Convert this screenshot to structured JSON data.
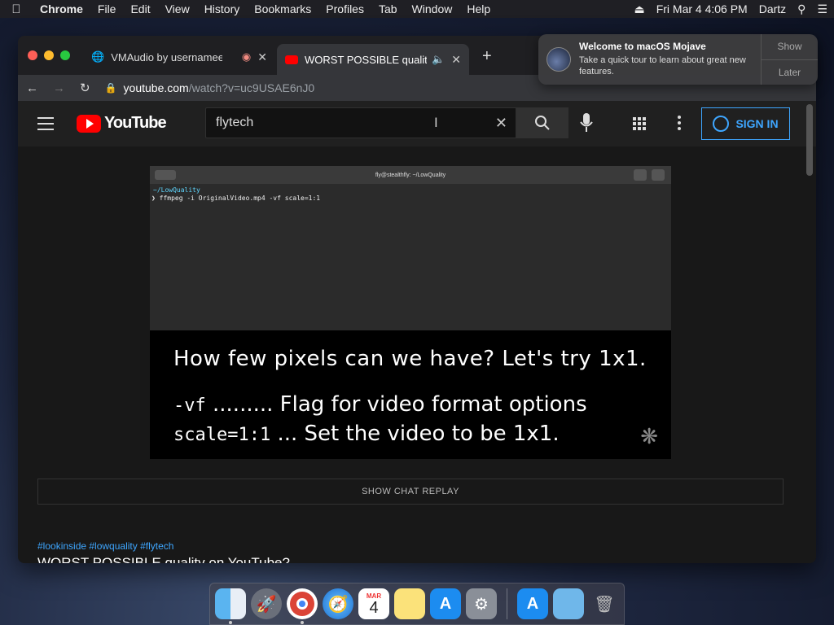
{
  "menubar": {
    "app": "Chrome",
    "items": [
      "File",
      "Edit",
      "View",
      "History",
      "Bookmarks",
      "Profiles",
      "Tab",
      "Window",
      "Help"
    ],
    "datetime": "Fri Mar 4  4:06 PM",
    "user": "Dartz"
  },
  "browser": {
    "tabs": [
      {
        "title": "VMAudio by usernamee",
        "icon": "globe-icon"
      },
      {
        "title": "WORST POSSIBLE quality",
        "icon": "youtube-icon",
        "active": true
      }
    ],
    "url_host": "youtube.com",
    "url_path": "/watch?v=uc9USAE6nJ0"
  },
  "youtube": {
    "logo_text": "YouTube",
    "search_value": "flytech",
    "signin_label": "SIGN IN"
  },
  "video": {
    "terminal_title": "fly@stealthfly: ~/LowQuality",
    "terminal_dir": "~/LowQuality",
    "terminal_cmd": "❯ ffmpeg -i OriginalVideo.mp4 -vf scale=1:1",
    "caption_line1": "How few pixels can we have? Let's try 1x1.",
    "caption_flag": "-vf",
    "caption_flag_desc": " ......... Flag for video format options",
    "caption_scale": "scale=1:1",
    "caption_scale_desc": " ... Set the video to be 1x1."
  },
  "chat_replay_label": "SHOW CHAT REPLAY",
  "hashtags": "#lookinside #lowquality #flytech",
  "video_title": "WORST POSSIBLE quality on YouTube?",
  "notification": {
    "title": "Welcome to macOS Mojave",
    "message": "Take a quick tour to learn about great new features.",
    "show_label": "Show",
    "later_label": "Later"
  },
  "calendar_icon": {
    "month": "MAR",
    "day": "4"
  },
  "colors": {
    "accent_blue": "#3ea6ff",
    "youtube_red": "#ff0000"
  }
}
